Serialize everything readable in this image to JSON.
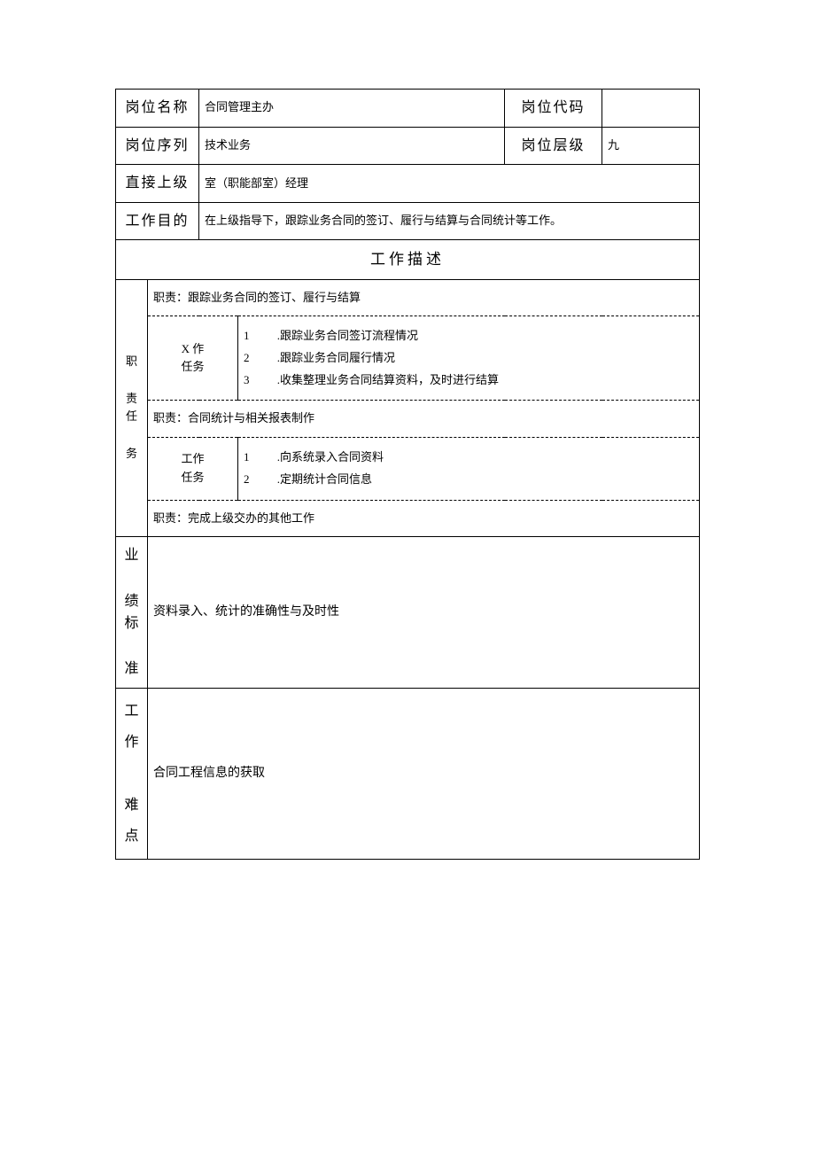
{
  "header": {
    "positionNameLabel": "岗位名称",
    "positionNameValue": "合同管理主办",
    "positionCodeLabel": "岗位代码",
    "positionCodeValue": "",
    "positionSeriesLabel": "岗位序列",
    "positionSeriesValue": "技术业务",
    "positionLevelLabel": "岗位层级",
    "positionLevelValue": "九",
    "directSuperiorLabel": "直接上级",
    "directSuperiorValue": "室（职能部室）经理",
    "workPurposeLabel": "工作目的",
    "workPurposeValue": "在上级指导下，跟踪业务合同的签订、履行与结算与合同统计等工作。"
  },
  "sectionTitle": "工作描述",
  "dutiesLabel": "职\n\n责任\n\n务",
  "duty1": {
    "title": "职责：跟踪业务合同的签订、履行与结算",
    "taskLabel": "X 作\n任务",
    "nums": "1\n2\n3",
    "texts": ".跟踪业务合同签订流程情况\n.跟踪业务合同履行情况\n.收集整理业务合同结算资料，及时进行结算"
  },
  "duty2": {
    "title": "职责：合同统计与相关报表制作",
    "taskLabel": "工作\n任务",
    "nums": "1\n2",
    "texts": ".向系统录入合同资料\n.定期统计合同信息"
  },
  "duty3": {
    "title": "职责：完成上级交办的其他工作"
  },
  "performance": {
    "label": "业\n\n绩标\n\n准",
    "value": "资料录入、统计的准确性与及时性"
  },
  "difficulty": {
    "label": "工作\n\n难点",
    "value": "合同工程信息的获取"
  }
}
